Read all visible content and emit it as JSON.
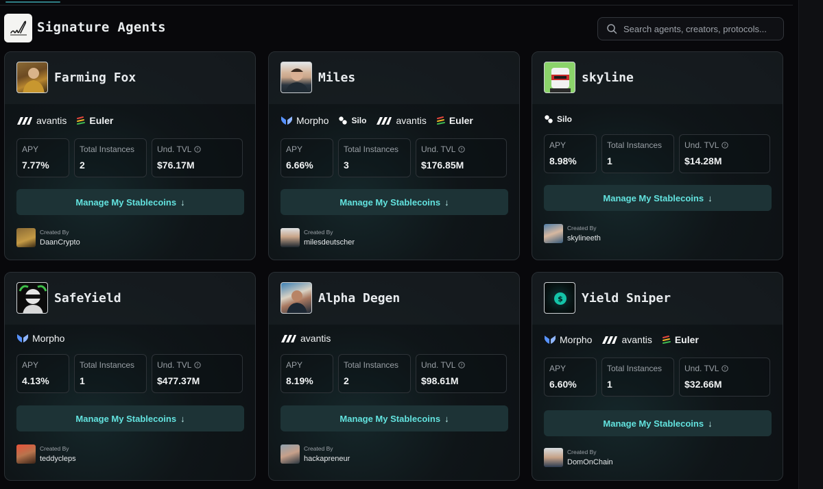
{
  "header": {
    "title": "Signature Agents",
    "search_placeholder": "Search agents, creators, protocols..."
  },
  "labels": {
    "apy": "APY",
    "total_instances": "Total Instances",
    "und_tvl": "Und. TVL",
    "manage": "Manage My Stablecoins",
    "created_by": "Created By"
  },
  "colors": {
    "accent": "#63e3df",
    "button_bg": "#1d3336",
    "card_border": "#2b3035"
  },
  "protocol_names": {
    "avantis": "avantis",
    "euler": "Euler",
    "morpho": "Morpho",
    "silo": "Silo"
  },
  "agents": [
    {
      "name": "Farming Fox",
      "apy": "7.77%",
      "instances": "2",
      "tvl": "$76.17M",
      "creator": "DaanCrypto",
      "protocols": [
        "avantis",
        "euler"
      ]
    },
    {
      "name": "Miles",
      "apy": "6.66%",
      "instances": "3",
      "tvl": "$176.85M",
      "creator": "milesdeutscher",
      "protocols": [
        "morpho",
        "silo",
        "avantis",
        "euler"
      ]
    },
    {
      "name": "skyline",
      "apy": "8.98%",
      "instances": "1",
      "tvl": "$14.28M",
      "creator": "skylineeth",
      "protocols": [
        "silo"
      ]
    },
    {
      "name": "SafeYield",
      "apy": "4.13%",
      "instances": "1",
      "tvl": "$477.37M",
      "creator": "teddycleps",
      "protocols": [
        "morpho"
      ]
    },
    {
      "name": "Alpha Degen",
      "apy": "8.19%",
      "instances": "2",
      "tvl": "$98.61M",
      "creator": "hackapreneur",
      "protocols": [
        "avantis"
      ]
    },
    {
      "name": "Yield Sniper",
      "apy": "6.60%",
      "instances": "1",
      "tvl": "$32.66M",
      "creator": "DomOnChain",
      "protocols": [
        "morpho",
        "avantis",
        "euler"
      ]
    }
  ]
}
